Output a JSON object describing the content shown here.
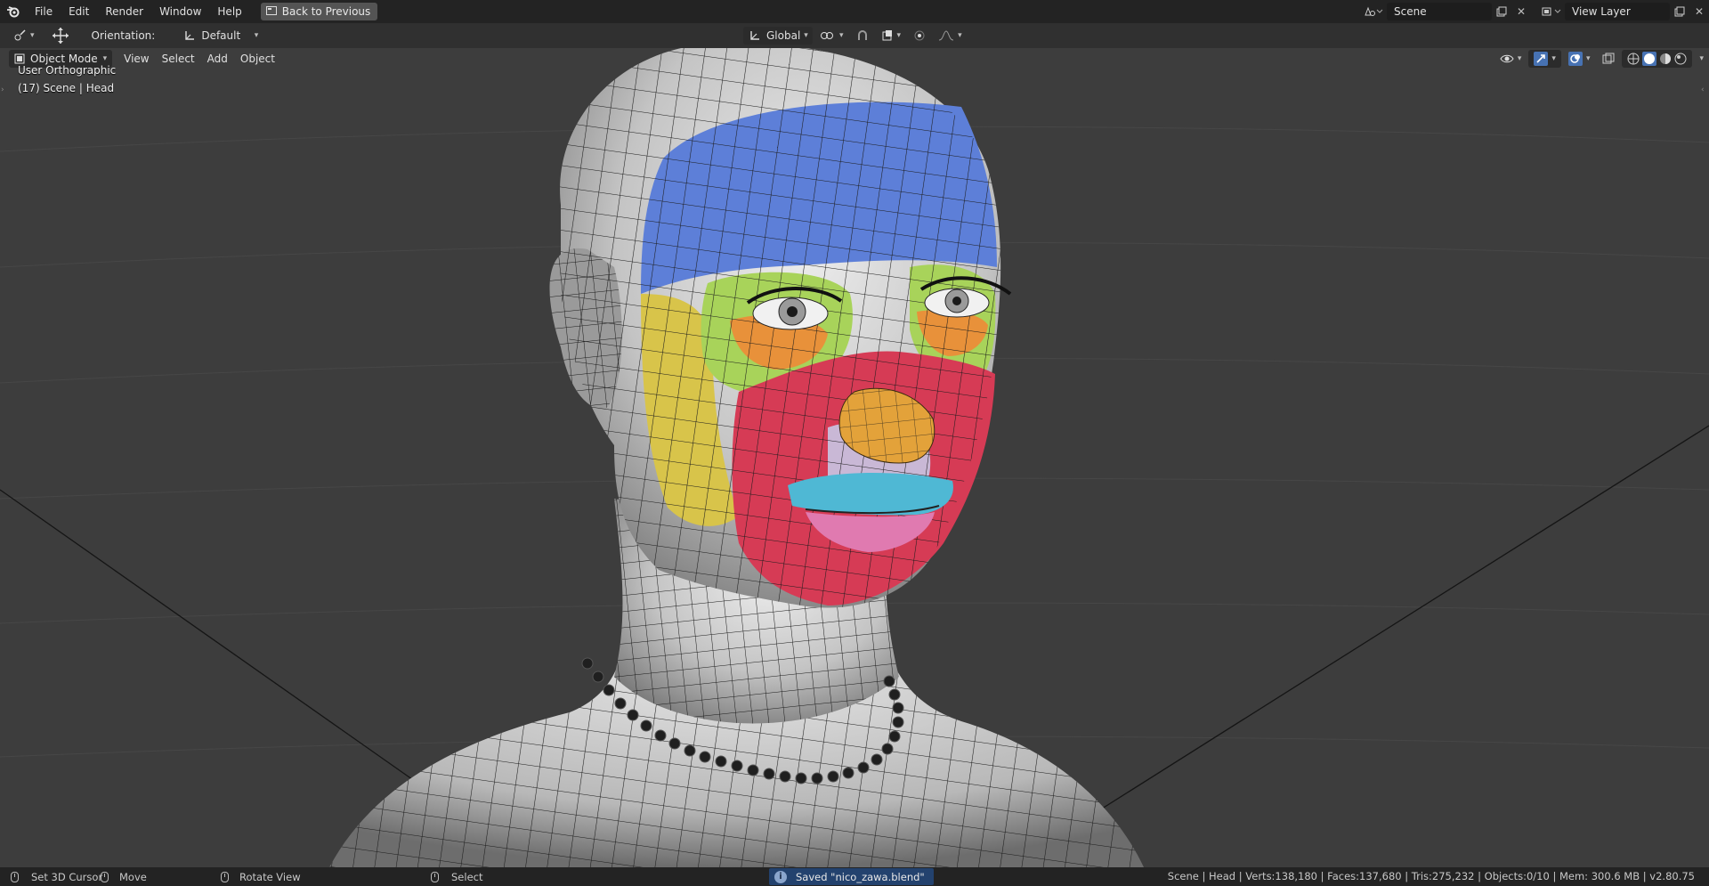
{
  "topbar": {
    "logo_icon": "blender-logo-icon",
    "menus": [
      "File",
      "Edit",
      "Render",
      "Window",
      "Help"
    ],
    "back_button": "Back to Previous",
    "scene_name": "Scene",
    "view_layer": "View Layer"
  },
  "toolheader": {
    "orientation_label": "Orientation:",
    "orientation_value": "Default",
    "transform_orientation": "Global"
  },
  "viewport": {
    "mode": "Object Mode",
    "menus": [
      "View",
      "Select",
      "Add",
      "Object"
    ],
    "view_name": "User Orthographic",
    "object_info": "(17) Scene | Head",
    "colors": {
      "background": "#3d3d3d",
      "forehead": "#5d7fd8",
      "skin": "#d9d9d9",
      "cheek": "#d63b55",
      "eye_region": "#a8d35a",
      "eye_inner": "#e8913a",
      "side_face": "#d8c44a",
      "nose": "#e3a23a",
      "upper_lip": "#4fb8d4",
      "lower_lip": "#e07ab0"
    }
  },
  "statusbar": {
    "set_cursor": "Set 3D Cursor",
    "move": "Move",
    "rotate_view": "Rotate View",
    "select": "Select",
    "saved_message": "Saved \"nico_zawa.blend\"",
    "stats": "Scene | Head | Verts:138,180 | Faces:137,680 | Tris:275,232 | Objects:0/10 | Mem: 300.6 MB | v2.80.75"
  }
}
